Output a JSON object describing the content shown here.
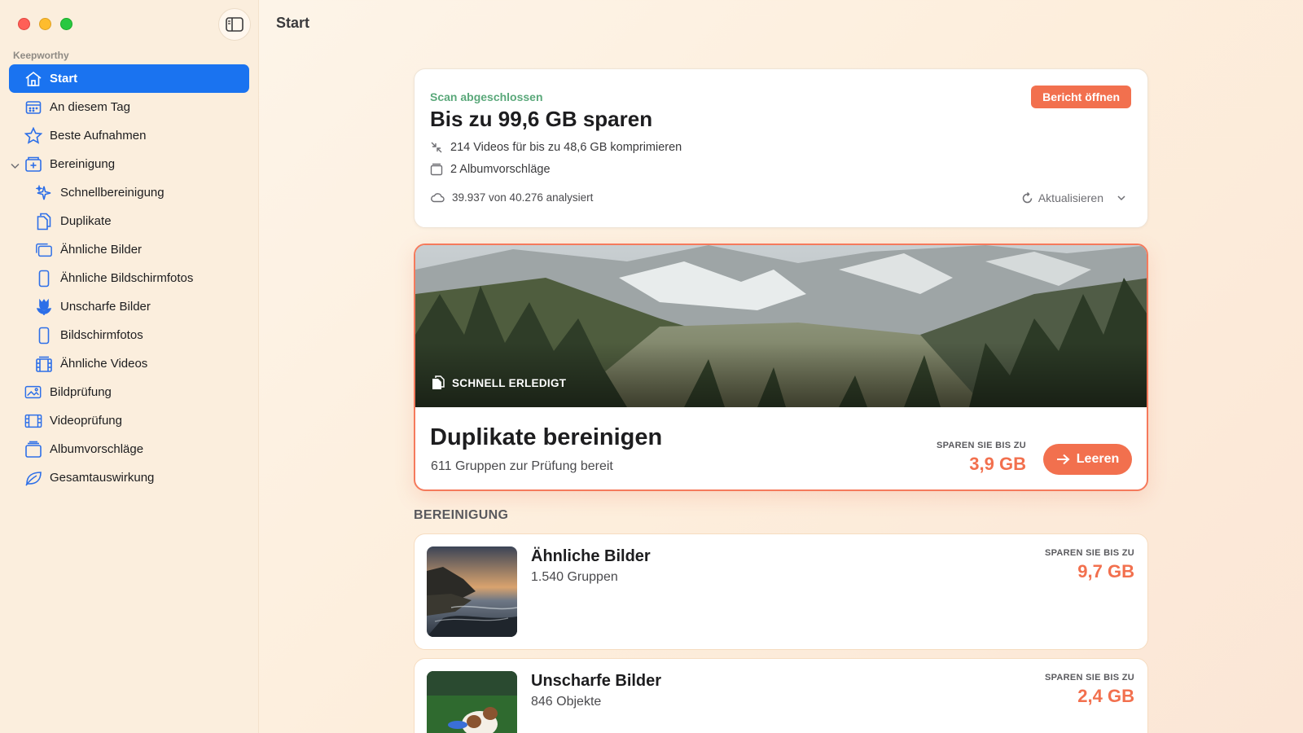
{
  "window": {
    "title": "Start"
  },
  "sidebar": {
    "section": "Keepworthy",
    "items": [
      {
        "label": "Start",
        "icon": "house-icon",
        "active": true
      },
      {
        "label": "An diesem Tag",
        "icon": "calendar-icon"
      },
      {
        "label": "Beste Aufnahmen",
        "icon": "star-icon"
      },
      {
        "label": "Bereinigung",
        "icon": "cleanup-box-icon",
        "expanded": true
      },
      {
        "label": "Schnellbereinigung",
        "icon": "sparkle-icon"
      },
      {
        "label": "Duplikate",
        "icon": "duplicate-doc-icon"
      },
      {
        "label": "Ähnliche Bilder",
        "icon": "stacked-photos-icon"
      },
      {
        "label": "Ähnliche Bildschirmfotos",
        "icon": "phone-icon"
      },
      {
        "label": "Unscharfe Bilder",
        "icon": "tulip-icon"
      },
      {
        "label": "Bildschirmfotos",
        "icon": "phone-icon"
      },
      {
        "label": "Ähnliche Videos",
        "icon": "film-stack-icon"
      },
      {
        "label": "Bildprüfung",
        "icon": "photo-review-icon"
      },
      {
        "label": "Videoprüfung",
        "icon": "film-icon"
      },
      {
        "label": "Albumvorschläge",
        "icon": "album-icon"
      },
      {
        "label": "Gesamtauswirkung",
        "icon": "leaf-icon"
      }
    ]
  },
  "summary": {
    "status": "Scan abgeschlossen",
    "title": "Bis zu 99,6 GB sparen",
    "report_button": "Bericht öffnen",
    "row_compress": "214 Videos für bis zu 48,6 GB komprimieren",
    "row_albums": "2 Albumvorschläge",
    "analyzed": "39.937 von 40.276 analysiert",
    "refresh": "Aktualisieren"
  },
  "featured": {
    "badge": "SCHNELL ERLEDIGT",
    "title": "Duplikate bereinigen",
    "subtitle": "611 Gruppen zur Prüfung bereit",
    "save_label": "SPAREN SIE BIS ZU",
    "save_value": "3,9 GB",
    "button": "Leeren"
  },
  "cleanup": {
    "heading": "BEREINIGUNG",
    "items": [
      {
        "title": "Ähnliche Bilder",
        "subtitle": "1.540 Gruppen",
        "save_label": "SPAREN SIE BIS ZU",
        "save_value": "9,7 GB"
      },
      {
        "title": "Unscharfe Bilder",
        "subtitle": "846 Objekte",
        "save_label": "SPAREN SIE BIS ZU",
        "save_value": "2,4 GB"
      }
    ]
  },
  "colors": {
    "accent": "#f2704e",
    "selection": "#1a73f0",
    "success": "#5aa87a"
  }
}
